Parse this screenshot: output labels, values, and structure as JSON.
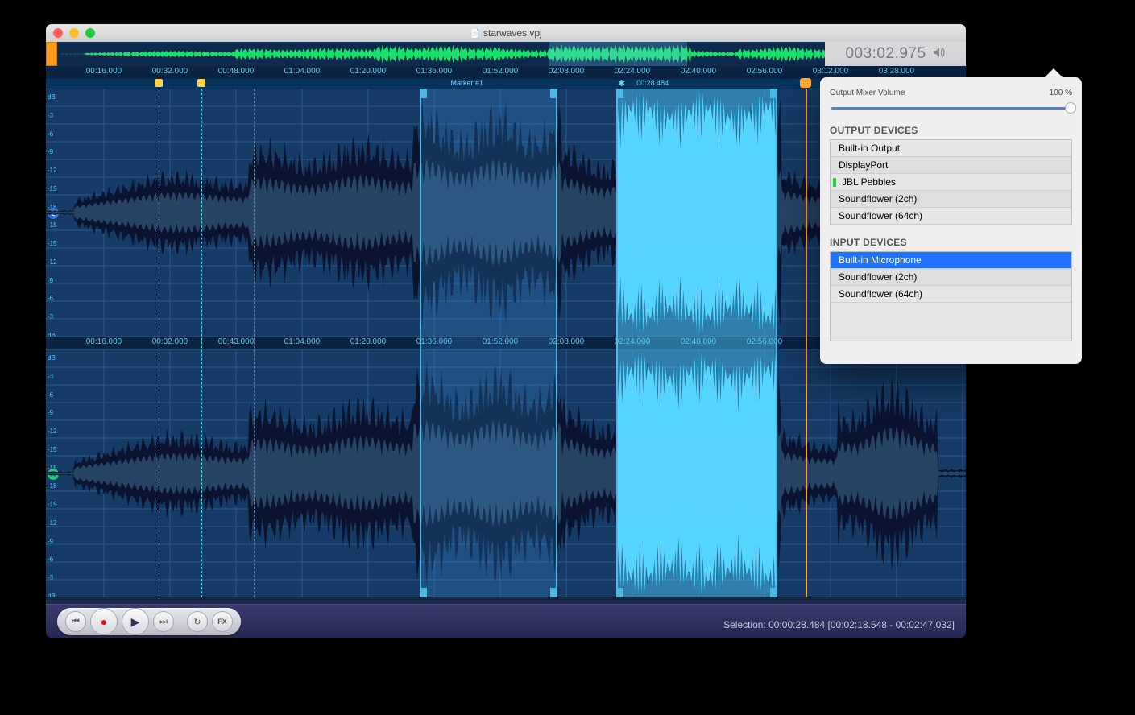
{
  "window": {
    "title": "starwaves.vpj"
  },
  "counter": "003:02.975",
  "ruler_top": [
    "00:16.000",
    "00:32.000",
    "00:48.000",
    "01:04.000",
    "01:20.000",
    "01:36.000",
    "01:52.000",
    "02:08.000",
    "02:24.000",
    "02:40.000",
    "02:56.000",
    "03:12.000",
    "03:28.000"
  ],
  "ruler_mid": [
    "00:16.000",
    "00:32.000",
    "00:43.000",
    "01:04.000",
    "01:20.000",
    "01:36.000",
    "01:52.000",
    "02:08.000",
    "02:24.000",
    "02:40.000",
    "02:56.000"
  ],
  "marker": {
    "label": "Marker #1",
    "time": "00:28.484"
  },
  "db_ticks": [
    0,
    -3,
    -6,
    -9,
    -12,
    -15,
    -18,
    -18,
    -15,
    -12,
    -9,
    -6,
    -3,
    0
  ],
  "selection_status": "Selection: 00:00:28.484 [00:02:18.548 - 00:02:47.032]",
  "popover": {
    "volume_label": "Output Mixer Volume",
    "volume_value": "100 %",
    "volume_pct": 100,
    "output_title": "OUTPUT DEVICES",
    "input_title": "INPUT DEVICES",
    "output_devices": [
      "Built-in Output",
      "DisplayPort",
      "JBL Pebbles",
      "Soundflower (2ch)",
      "Soundflower (64ch)"
    ],
    "output_active_index": 2,
    "input_devices": [
      "Built-in Microphone",
      "Soundflower (2ch)",
      "Soundflower (64ch)"
    ],
    "input_selected_index": 0
  },
  "regions": [
    {
      "start_pct": 40.6,
      "end_pct": 55.6,
      "sel": false
    },
    {
      "start_pct": 62.0,
      "end_pct": 79.5,
      "sel": true
    }
  ],
  "cursors": {
    "green1_pct": 12.3,
    "green2_pct": 16.9,
    "red_pct": 22.6,
    "playhead_pct": 82.6
  }
}
